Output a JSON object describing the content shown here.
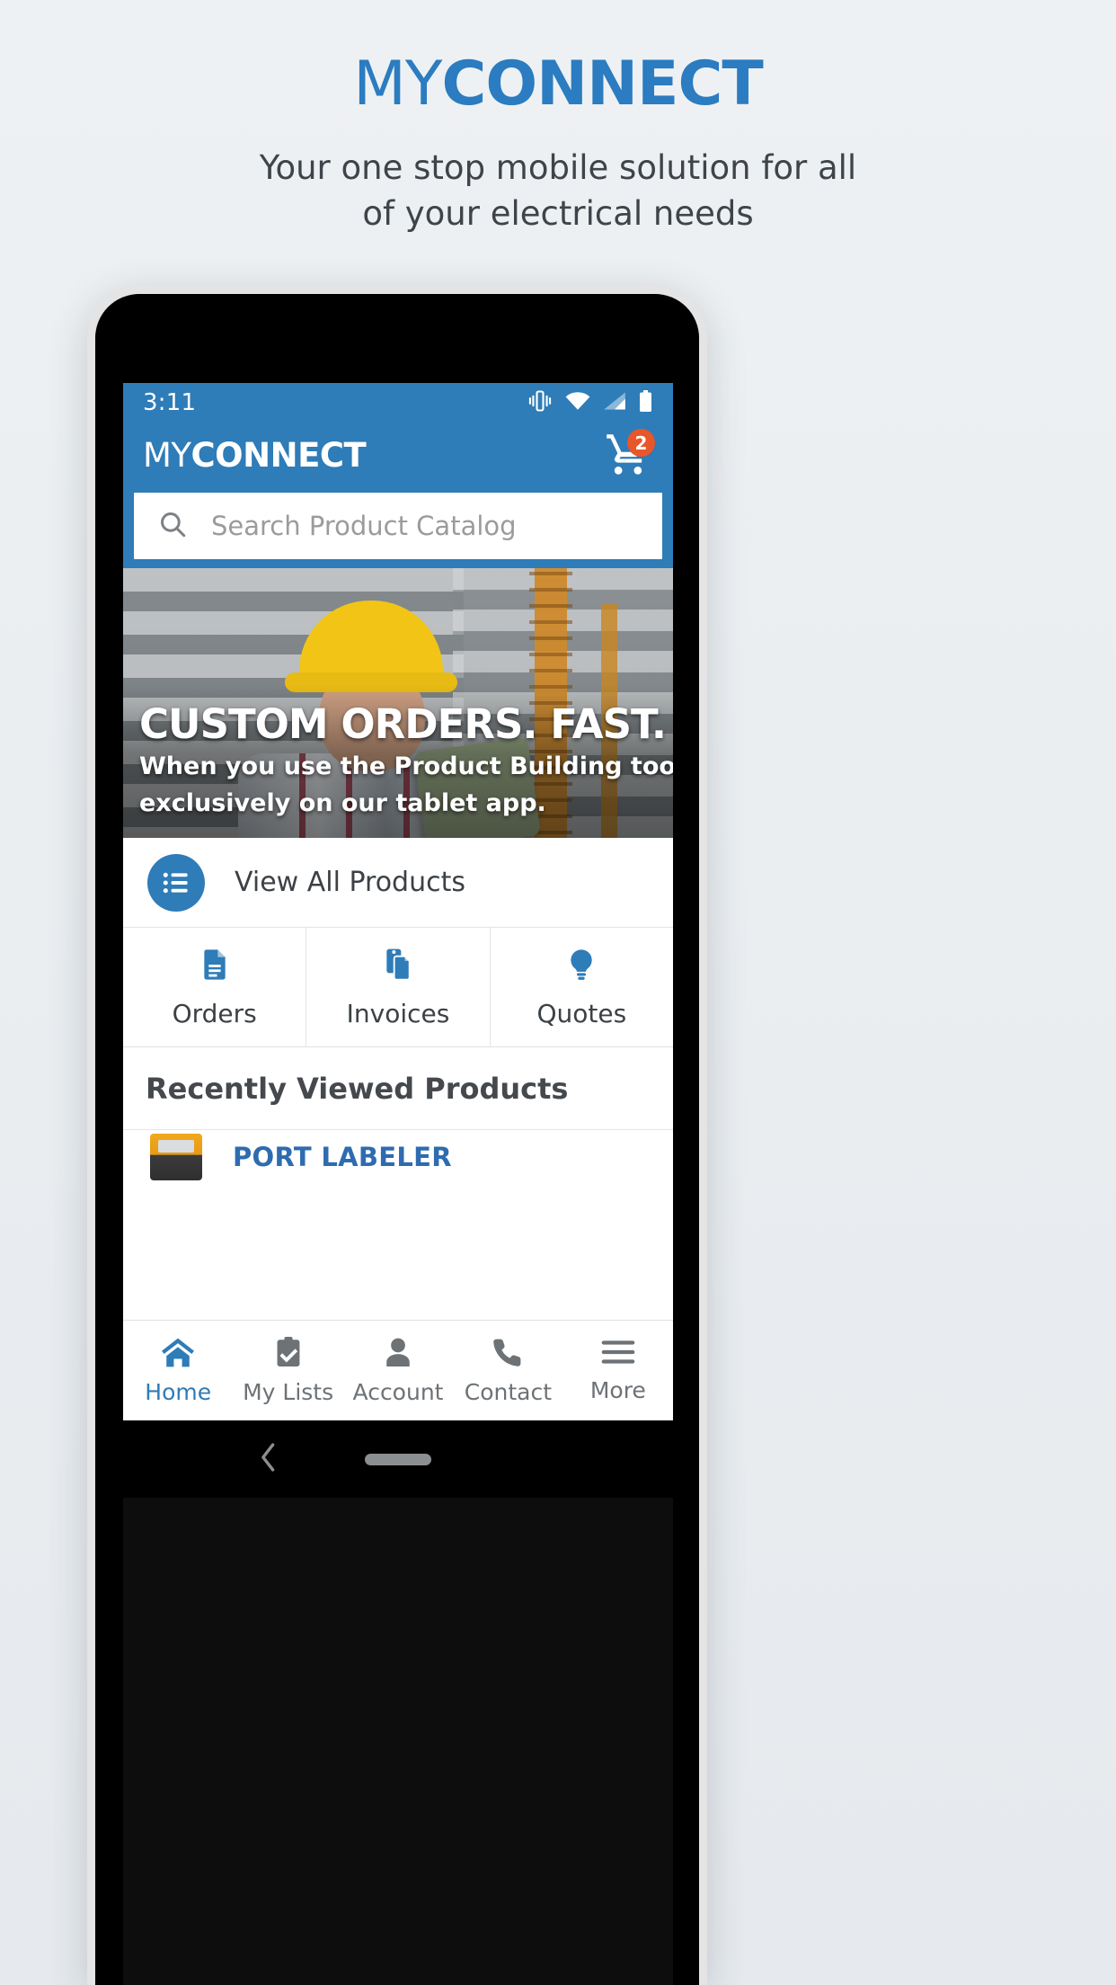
{
  "promo": {
    "title_light": "MY",
    "title_bold": "CONNECT",
    "subtitle": "Your one stop mobile solution for all of your electrical needs",
    "brand_color": "#2b7cc0"
  },
  "phone": {
    "statusbar": {
      "time": "3:11",
      "icons": [
        "vibrate-icon",
        "wifi-icon",
        "cellular-signal-icon",
        "battery-icon"
      ],
      "background": "#2e7cb8"
    },
    "appbar": {
      "logo_light": "MY",
      "logo_bold": "CONNECT",
      "cart_icon": "shopping-cart-icon",
      "cart_badge_count": "2",
      "cart_badge_color": "#e8562a",
      "background": "#2e7cb8"
    },
    "search": {
      "placeholder": "Search Product Catalog",
      "icon": "search-icon"
    },
    "hero": {
      "title": "CUSTOM ORDERS. FAST.",
      "line1": "When you use the Product Building tool,",
      "line2": "exclusively on our tablet app."
    },
    "view_all": {
      "label": "View All Products",
      "icon": "list-icon"
    },
    "tiles": [
      {
        "label": "Orders",
        "icon": "document-icon"
      },
      {
        "label": "Invoices",
        "icon": "copy-documents-icon"
      },
      {
        "label": "Quotes",
        "icon": "lightbulb-icon"
      }
    ],
    "recent": {
      "title": "Recently Viewed Products",
      "items": [
        {
          "name": "PORT LABELER",
          "thumb": "label-printer-thumbnail"
        }
      ]
    },
    "bottom_nav": {
      "active": "Home",
      "items": [
        {
          "label": "Home",
          "icon": "home-icon"
        },
        {
          "label": "My Lists",
          "icon": "clipboard-check-icon"
        },
        {
          "label": "Account",
          "icon": "person-icon"
        },
        {
          "label": "Contact",
          "icon": "phone-icon"
        },
        {
          "label": "More",
          "icon": "hamburger-menu-icon"
        }
      ],
      "active_color": "#2e7cb8",
      "inactive_color": "#6d7276"
    },
    "system_nav": {
      "back_icon": "back-chevron-icon",
      "home_pill": "home-indicator-pill"
    }
  }
}
